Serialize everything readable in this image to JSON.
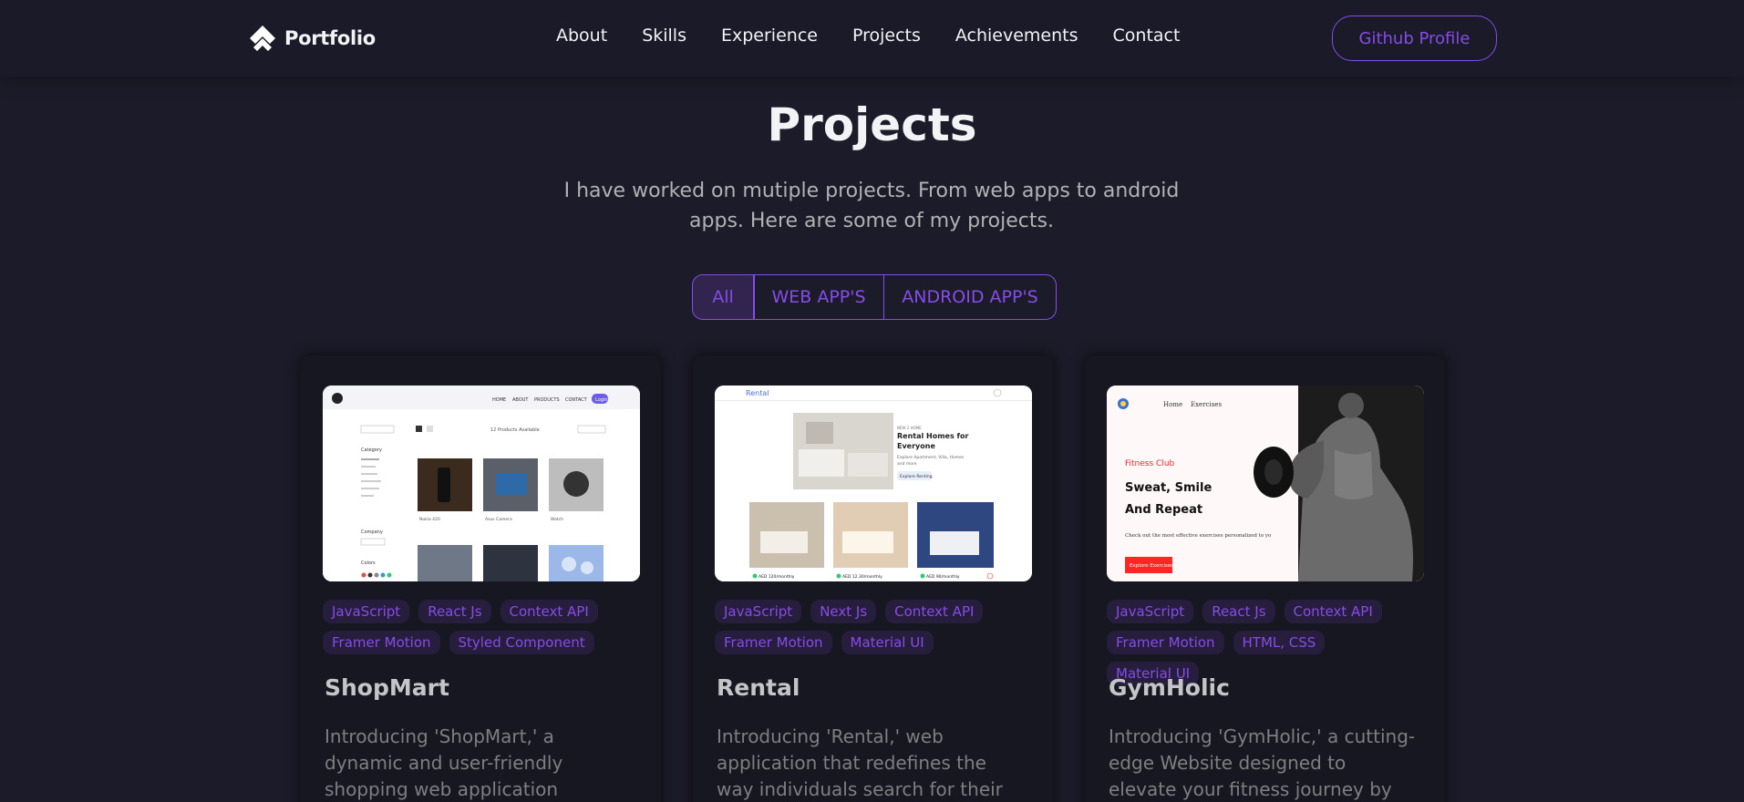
{
  "nav": {
    "logo_text": "Portfolio",
    "links": [
      "About",
      "Skills",
      "Experience",
      "Projects",
      "Achievements",
      "Contact"
    ],
    "github_label": "Github Profile"
  },
  "section": {
    "title": "Projects",
    "description": "I have worked on mutiple projects. From web apps to android apps. Here are some of my projects."
  },
  "toggle": {
    "items": [
      "All",
      "WEB APP'S",
      "ANDROID APP'S"
    ],
    "active": "All"
  },
  "projects": [
    {
      "title": "ShopMart",
      "tags": [
        "JavaScript",
        "React Js",
        "Context API",
        "Framer Motion",
        "Styled Component"
      ],
      "description": "Introducing 'ShopMart,' a dynamic and user-friendly shopping web application designed to the online…",
      "preview": {
        "nav": [
          "HOME",
          "ABOUT",
          "PRODUCTS",
          "CONTACT"
        ],
        "login": "Login",
        "products_available": "12 Products Available",
        "category_label": "Category",
        "company_label": "Company",
        "colors_label": "Colors",
        "product_names": [
          "Nokia 420",
          "Asus Camera",
          "Watch"
        ]
      }
    },
    {
      "title": "Rental",
      "tags": [
        "JavaScript",
        "Next Js",
        "Context API",
        "Framer Motion",
        "Material UI"
      ],
      "description": "Introducing 'Rental,' web application that redefines the way individuals search for their homes.…",
      "preview": {
        "brand": "Rental",
        "headline": "Rental Homes for Everyone",
        "sub": "Explore Apartment, Villa, Homes and more",
        "cta": "Explore Renting",
        "prices": [
          "AED 120/monthly",
          "AED 12.30/monthly",
          "AED 90/monthly"
        ]
      }
    },
    {
      "title": "GymHolic",
      "tags": [
        "JavaScript",
        "React Js",
        "Context API",
        "Framer Motion",
        "HTML, CSS",
        "Material UI"
      ],
      "description": "Introducing 'GymHolic,' a cutting-edge Website designed to elevate your fitness journey by providing a…",
      "preview": {
        "nav": [
          "Home",
          "Exercises"
        ],
        "badge": "Fitness Club",
        "headline_1": "Sweat, Smile",
        "headline_2": "And Repeat",
        "sub": "Check out the most effective exercises personalized to you",
        "cta": "Explore Exercises"
      }
    }
  ],
  "colors": {
    "accent": "#854ce6",
    "background": "#1c1b29",
    "card": "#171721",
    "text_primary": "#f2f3f4",
    "text_secondary": "#b1b2b3"
  }
}
